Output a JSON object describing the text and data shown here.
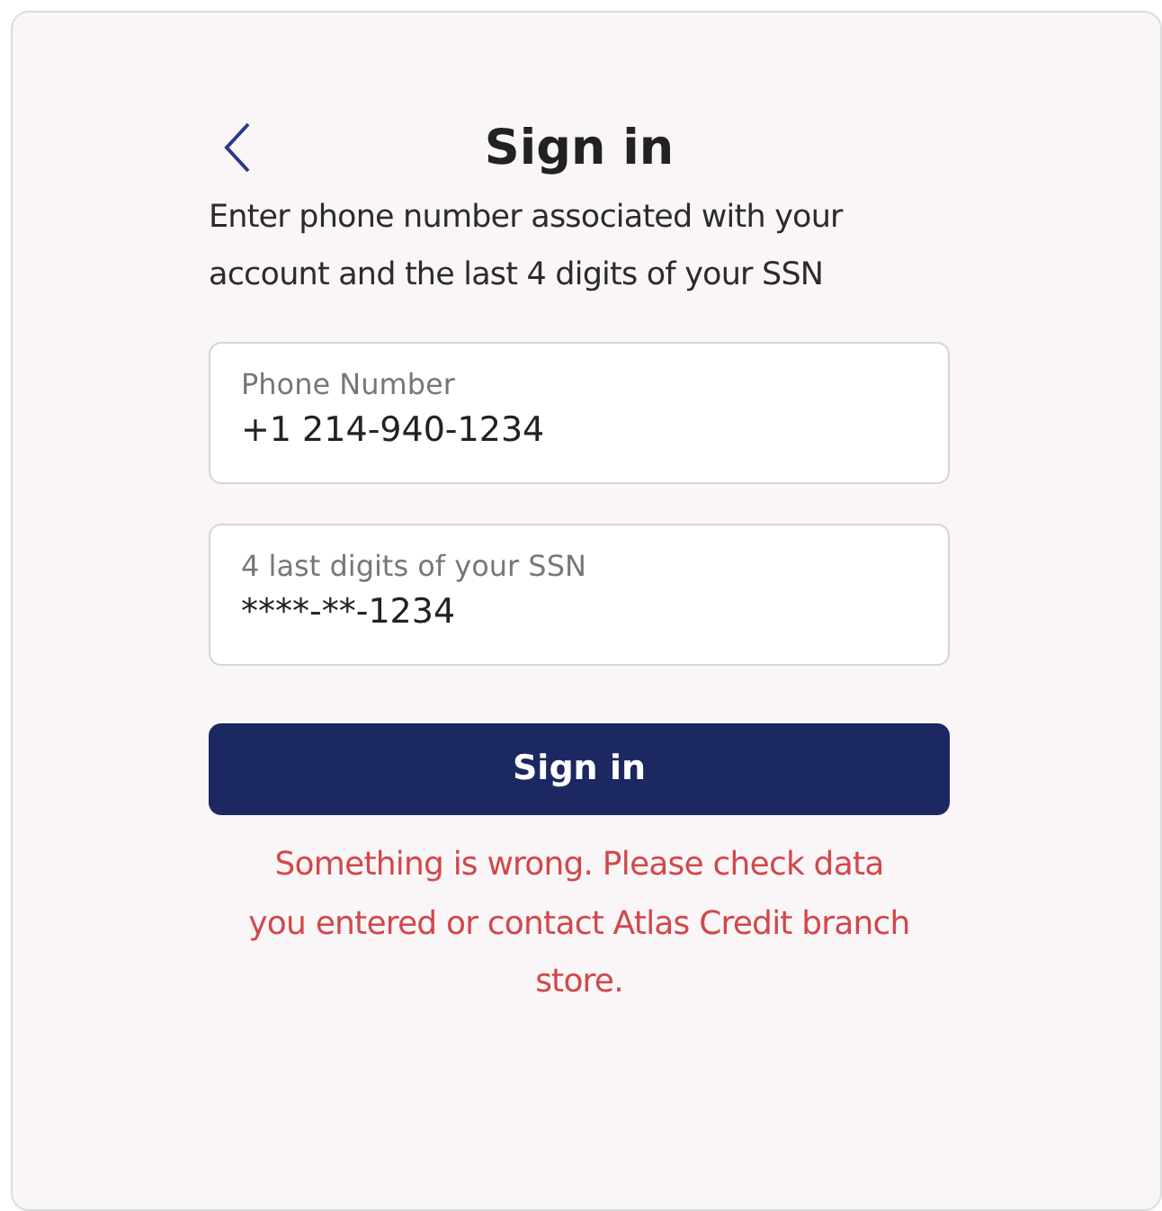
{
  "header": {
    "title": "Sign in"
  },
  "description": "Enter phone number associated with your account and the last 4 digits of your SSN",
  "fields": [
    {
      "label": "Phone Number",
      "value": "+1 214-940-1234"
    },
    {
      "label": "4 last digits of your SSN",
      "value": "****-**-1234"
    }
  ],
  "submit_button": "Sign in",
  "error_message": "Something is wrong. Please check data you entered or contact Atlas Credit branch store."
}
